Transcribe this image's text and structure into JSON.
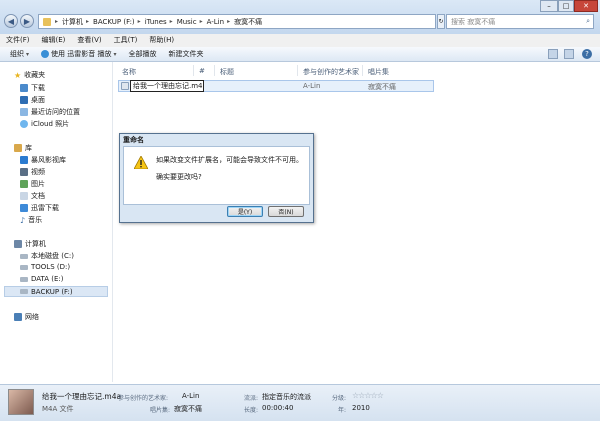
{
  "address": {
    "crumbs": [
      "计算机",
      "BACKUP (F:)",
      "iTunes",
      "Music",
      "A-Lin",
      "寂寞不痛"
    ]
  },
  "search": {
    "placeholder": "搜索 寂寞不痛"
  },
  "menu": [
    "文件(F)",
    "编辑(E)",
    "查看(V)",
    "工具(T)",
    "帮助(H)"
  ],
  "toolbar": {
    "organize": "组织",
    "play_with": "使用 迅雷影音 播放",
    "play_all": "全部播放",
    "new_folder": "新建文件夹"
  },
  "nav": {
    "favorites": "收藏夹",
    "download": "下载",
    "desktop": "桌面",
    "recent": "最近访问的位置",
    "icloud": "iCloud 照片",
    "library": "库",
    "storm": "暴风影视库",
    "videos": "视频",
    "pictures": "图片",
    "documents": "文档",
    "xunlei": "迅雷下载",
    "music": "音乐",
    "computer": "计算机",
    "local_c": "本地磁盘 (C:)",
    "tools_d": "TOOLS (D:)",
    "data_e": "DATA (E:)",
    "backup_f": "BACKUP (F:)",
    "network": "网络"
  },
  "columns": {
    "name": "名称",
    "num": "#",
    "title": "标题",
    "artist": "参与创作的艺术家",
    "album": "唱片集"
  },
  "file": {
    "name": "给我一个理由忘记.m4r",
    "artist": "A-Lin",
    "album": "寂寞不痛"
  },
  "dialog": {
    "title": "重命名",
    "message": "如果改变文件扩展名，可能会导致文件不可用。",
    "question": "确实要更改吗?",
    "yes": "是(Y)",
    "no": "否(N)"
  },
  "status": {
    "filename": "给我一个理由忘记.m4a",
    "filetype": "M4A 文件",
    "artist_label": "参与创作的艺术家:",
    "artist": "A-Lin",
    "album_label": "唱片集:",
    "album": "寂寞不痛",
    "genre_label": "流派:",
    "genre": "指定音乐的流派",
    "length_label": "长度:",
    "length": "00:00:40",
    "rating_label": "分级:",
    "year_label": "年:",
    "year": "2010"
  },
  "colors": {
    "accent": "#3c6ea5",
    "dialog_bg": "#d9e6f3",
    "selection": "#e6f0fb"
  }
}
